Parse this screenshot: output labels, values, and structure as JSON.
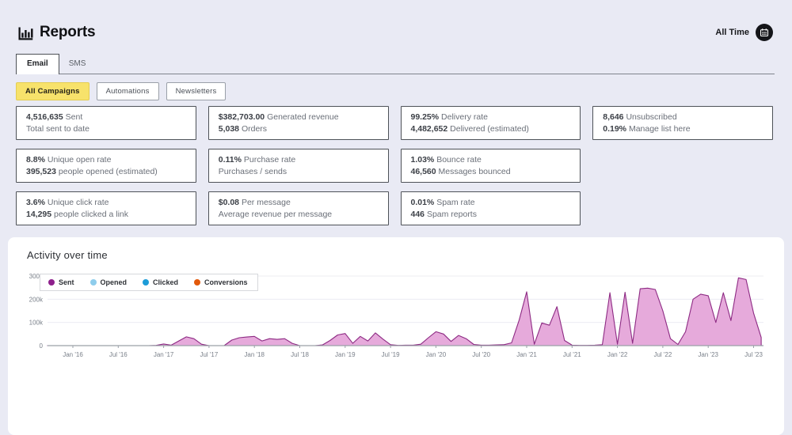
{
  "header": {
    "title": "Reports",
    "date_range_label": "All Time"
  },
  "tabs": [
    {
      "label": "Email",
      "active": true
    },
    {
      "label": "SMS",
      "active": false
    }
  ],
  "filters": [
    {
      "label": "All Campaigns",
      "active": true
    },
    {
      "label": "Automations",
      "active": false
    },
    {
      "label": "Newsletters",
      "active": false
    }
  ],
  "cards": [
    {
      "b1": "4,516,635",
      "r1": "Sent",
      "b2": "",
      "r2": "Total sent to date"
    },
    {
      "b1": "$382,703.00",
      "r1": "Generated revenue",
      "b2": "5,038",
      "r2": "Orders"
    },
    {
      "b1": "99.25%",
      "r1": "Delivery rate",
      "b2": "4,482,652",
      "r2": "Delivered (estimated)"
    },
    {
      "b1": "8,646",
      "r1": "Unsubscribed",
      "b2": "0.19%",
      "r2": "Manage list here"
    },
    {
      "b1": "8.8%",
      "r1": "Unique open rate",
      "b2": "395,523",
      "r2": "people opened (estimated)"
    },
    {
      "b1": "0.11%",
      "r1": "Purchase rate",
      "b2": "",
      "r2": "Purchases / sends"
    },
    {
      "b1": "1.03%",
      "r1": "Bounce rate",
      "b2": "46,560",
      "r2": "Messages bounced"
    },
    {
      "b1": "3.6%",
      "r1": "Unique click rate",
      "b2": "14,295",
      "r2": "people clicked a link"
    },
    {
      "b1": "$0.08",
      "r1": "Per message",
      "b2": "",
      "r2": "Average revenue per message"
    },
    {
      "b1": "0.01%",
      "r1": "Spam rate",
      "b2": "446",
      "r2": "Spam reports"
    }
  ],
  "colors": {
    "page_bg": "#e9eaf4",
    "accent_yellow": "#f7e26b",
    "card_border": "#4d5157"
  },
  "chart_data": {
    "type": "area",
    "title": "Activity over time",
    "x_unit": "month",
    "x_range": [
      "Jan 2016",
      "Aug 2023"
    ],
    "x_tick_labels": [
      "Jan '16",
      "Jul '16",
      "Jan '17",
      "Jul '17",
      "Jan '18",
      "Jul '18",
      "Jan '19",
      "Jul '19",
      "Jan '20",
      "Jul '20",
      "Jan '21",
      "Jul '21",
      "Jan '22",
      "Jul '22",
      "Jan '23",
      "Jul '23"
    ],
    "y_ticks": [
      {
        "label": "300k",
        "k": 300
      },
      {
        "label": "200k",
        "k": 200
      },
      {
        "label": "100k",
        "k": 100
      },
      {
        "label": "0",
        "k": 0
      }
    ],
    "y_max_k": 300,
    "grid": true,
    "legend_position": "top-left",
    "series": [
      {
        "name": "Sent",
        "color": "#8e208c",
        "stroke": "#8d2a83",
        "fill": "#e6aadb",
        "values_k": [
          0,
          0,
          0,
          0,
          0,
          0,
          0,
          0,
          0,
          0,
          0,
          1,
          7,
          2,
          20,
          38,
          30,
          6,
          0,
          0,
          0,
          24,
          34,
          37,
          40,
          20,
          30,
          27,
          30,
          10,
          0,
          0,
          0,
          3,
          22,
          46,
          52,
          10,
          40,
          20,
          55,
          28,
          4,
          1,
          2,
          2,
          6,
          34,
          60,
          50,
          18,
          44,
          30,
          5,
          2,
          2,
          3,
          4,
          12,
          110,
          232,
          6,
          98,
          88,
          168,
          22,
          2,
          1,
          1,
          2,
          4,
          228,
          6,
          230,
          10,
          245,
          248,
          242,
          150,
          30,
          5,
          60,
          200,
          222,
          215,
          100,
          228,
          108,
          292,
          285,
          140,
          35
        ]
      },
      {
        "name": "Opened",
        "color": "#8ecdec",
        "stroke": "#8fa5dc",
        "fill": "#a2b3e4",
        "values_k": [
          0,
          0,
          0,
          0,
          0,
          0,
          0,
          0,
          0,
          0,
          0,
          0,
          1,
          0,
          3,
          5,
          4,
          1,
          0,
          0,
          0,
          3,
          4,
          5,
          5,
          3,
          4,
          4,
          4,
          1,
          0,
          0,
          0,
          0,
          3,
          6,
          6,
          1,
          5,
          3,
          6,
          3,
          0,
          0,
          0,
          0,
          1,
          4,
          7,
          6,
          2,
          5,
          4,
          1,
          0,
          0,
          0,
          1,
          2,
          10,
          14,
          1,
          8,
          7,
          12,
          2,
          0,
          0,
          0,
          0,
          1,
          15,
          1,
          15,
          1,
          16,
          16,
          15,
          10,
          3,
          1,
          5,
          14,
          16,
          15,
          8,
          17,
          9,
          26,
          24,
          12,
          4
        ]
      },
      {
        "name": "Clicked",
        "color": "#1d9cd8",
        "stroke": "#1d9cd8",
        "fill": "#1d9cd8",
        "values_k": []
      },
      {
        "name": "Conversions",
        "color": "#e2590b",
        "stroke": "#e2590b",
        "fill": "#e2590b",
        "values_k": []
      }
    ]
  }
}
